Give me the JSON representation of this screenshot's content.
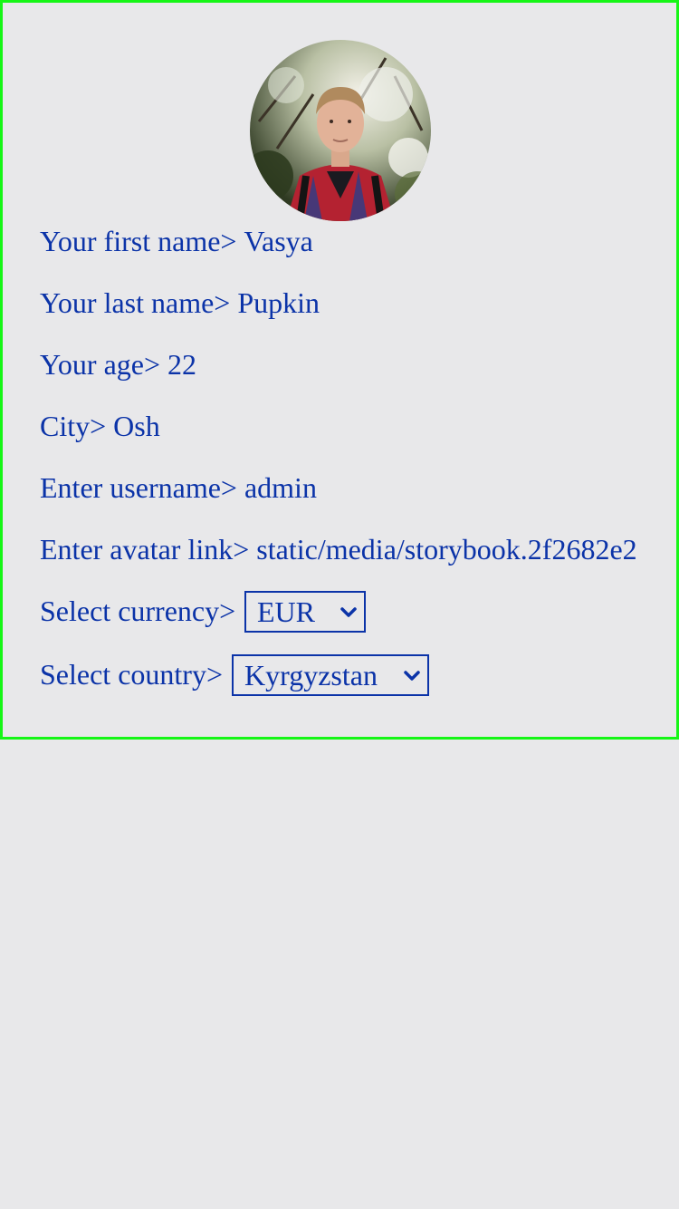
{
  "profile": {
    "avatar_alt": "avatar",
    "first_name_label": "Your first name>",
    "first_name_value": "Vasya",
    "last_name_label": "Your last name>",
    "last_name_value": "Pupkin",
    "age_label": "Your age>",
    "age_value": "22",
    "city_label": "City>",
    "city_value": "Osh",
    "username_label": "Enter username>",
    "username_value": "admin",
    "avatar_label": "Enter avatar link>",
    "avatar_value": "static/media/storybook.2f2682e2",
    "currency_label": "Select currency>",
    "currency_value": "EUR",
    "country_label": "Select country>",
    "country_value": "Kyrgyzstan"
  },
  "colors": {
    "text": "#0b33a8",
    "border": "#16f616",
    "background": "#e8e8ea"
  }
}
